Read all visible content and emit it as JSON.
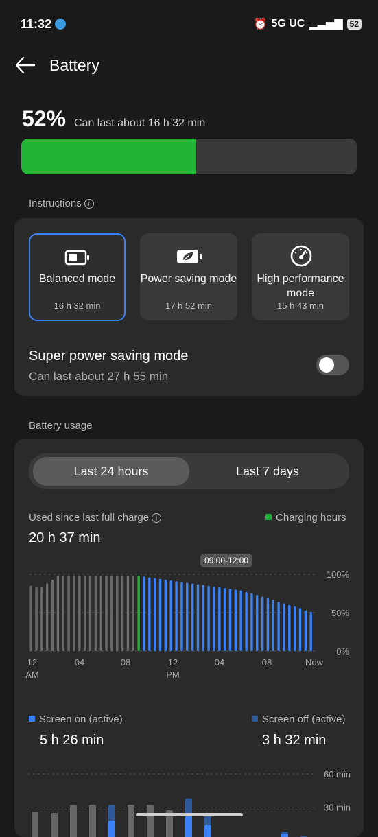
{
  "status": {
    "time": "11:32",
    "network": "5G UC",
    "battery": "52"
  },
  "header": {
    "title": "Battery"
  },
  "battery": {
    "percent": "52%",
    "percent_value": 52,
    "estimate": "Can last about 16 h 32 min"
  },
  "instructions": {
    "label": "Instructions"
  },
  "modes": [
    {
      "label": "Balanced mode",
      "time": "16 h 32 min",
      "icon": "battery-icon"
    },
    {
      "label": "Power saving mode",
      "time": "17 h 52 min",
      "icon": "leaf-battery-icon"
    },
    {
      "label": "High performance mode",
      "time": "15 h 43 min",
      "icon": "speedometer-icon"
    }
  ],
  "super_saving": {
    "title": "Super power saving mode",
    "subtitle": "Can last about 27 h 55 min",
    "enabled": false
  },
  "usage": {
    "label": "Battery usage",
    "tabs": [
      "Last 24 hours",
      "Last 7 days"
    ],
    "used_label": "Used since last full charge",
    "used_value": "20 h 37 min",
    "charging_legend": "Charging hours",
    "tooltip": "09:00-12:00",
    "screen_on_label": "Screen on (active)",
    "screen_on_value": "5 h 26 min",
    "screen_off_label": "Screen off (active)",
    "screen_off_value": "3 h 32 min"
  },
  "colors": {
    "charge": "#22b535",
    "accent": "#3b82f6",
    "screen_off": "#2f5a9a",
    "grey_bar": "#6b6b6b"
  },
  "chart_data": [
    {
      "type": "bar",
      "ylabels": [
        "100%",
        "50%",
        "0%"
      ],
      "xlabels": [
        "12\nAM",
        "04",
        "08",
        "12\nPM",
        "04",
        "08",
        "Now"
      ],
      "ylim": [
        0,
        100
      ],
      "series": [
        {
          "values": [
            85,
            83,
            83,
            88,
            93,
            98,
            98,
            98,
            98,
            98,
            98,
            98,
            98,
            98,
            98,
            98,
            98,
            98,
            98,
            98,
            98,
            97,
            96,
            95,
            94,
            93,
            92,
            91,
            90,
            89,
            88,
            87,
            86,
            85,
            84,
            83,
            82,
            81,
            80,
            79,
            77,
            75,
            73,
            71,
            69,
            67,
            64,
            62,
            60,
            58,
            56,
            53,
            51
          ]
        }
      ]
    },
    {
      "type": "bar",
      "ylabels": [
        "60 min",
        "30 min"
      ],
      "ylim": [
        0,
        60
      ],
      "series": [
        {
          "name": "Screen on (active)",
          "values": [
            12,
            0,
            14,
            2,
            18,
            0,
            8,
            20,
            22,
            14,
            0,
            0,
            0,
            6,
            3
          ]
        },
        {
          "name": "Screen off (active)",
          "values": [
            0,
            0,
            0,
            0,
            14,
            0,
            0,
            0,
            16,
            8,
            0,
            0,
            0,
            2,
            1
          ]
        }
      ]
    }
  ]
}
